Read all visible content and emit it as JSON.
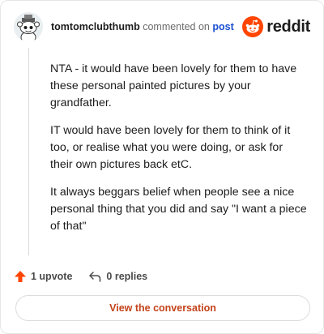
{
  "header": {
    "username": "tomtomclubthumb",
    "action_text": "commented on",
    "post_label": "post",
    "brand": "reddit",
    "brand_color": "#ff4500",
    "avatar_icon": "snoo-avatar-icon"
  },
  "comment": {
    "paragraphs": [
      "NTA - it would have been lovely for them to have these personal painted pictures by your grandfather.",
      "IT would have been lovely for them to think of it too, or realise what you were doing, or ask for their own pictures back etC.",
      "It always beggars belief when people see a nice personal thing that you did and say \"I want a piece of that\""
    ]
  },
  "actions": {
    "upvote_label": "1 upvote",
    "upvote_icon": "upvote-arrow-icon",
    "upvote_color": "#ff4500",
    "replies_label": "0 replies",
    "replies_icon": "reply-arrow-icon"
  },
  "cta": {
    "label": "View the conversation",
    "color": "#c4421a"
  }
}
